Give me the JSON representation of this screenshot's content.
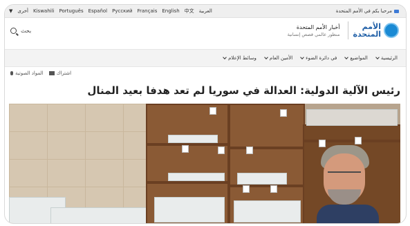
{
  "langbar": {
    "languages": [
      "Kiswahili",
      "Português",
      "Español",
      "Русский",
      "Français",
      "English",
      "中文",
      "العربية"
    ],
    "more_label": "أخرى",
    "welcome": "مرحبا بكم في الأمم المتحدة"
  },
  "header": {
    "search_label": "بحث",
    "logo_line1": "الأمم",
    "logo_line2": "المتحدة",
    "title": "أخبار الأمم المتحدة",
    "subtitle": "منظور عالمي قصص إنسانية"
  },
  "nav": {
    "items": [
      "الرئيسية",
      "المواضيع",
      "في دائرة الضوء",
      "الأمين العام",
      "وسائط الإعلام"
    ]
  },
  "share": {
    "audio_label": "المواد الصوتية",
    "subscribe_label": "اشتراك"
  },
  "article": {
    "headline": "رئيس الآلية الدولية: العدالة في سوريا لم تعد هدفا بعيد المنال"
  }
}
